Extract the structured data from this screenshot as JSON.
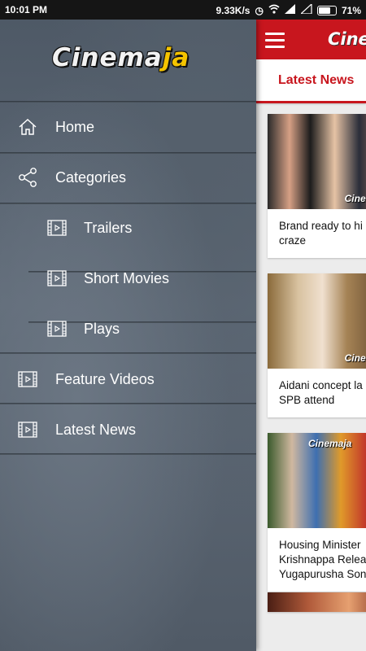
{
  "status": {
    "time": "10:01 PM",
    "speed": "9.33K/s",
    "battery": "71%"
  },
  "drawer": {
    "logo": {
      "part1": "Cinema",
      "part2": "ja"
    },
    "items": [
      {
        "label": "Home",
        "icon": "home-icon"
      },
      {
        "label": "Categories",
        "icon": "share-icon"
      },
      {
        "label": "Trailers",
        "icon": "film-icon"
      },
      {
        "label": "Short Movies",
        "icon": "film-icon"
      },
      {
        "label": "Plays",
        "icon": "film-icon"
      },
      {
        "label": "Feature Videos",
        "icon": "film-icon"
      },
      {
        "label": "Latest News",
        "icon": "film-icon"
      }
    ]
  },
  "app": {
    "logo": "Cinema",
    "tab": "Latest News",
    "accent": "#c8161e",
    "cards": [
      {
        "caption": "Brand ready to hi\ncraze",
        "watermark": "Cinemaja"
      },
      {
        "caption": "Aidani concept la\nSPB attend",
        "watermark": "Cinemaja"
      },
      {
        "caption": "Housing Minister\nKrishnappa Relea\nYugapurusha Son",
        "watermark": "Cinemaja"
      }
    ]
  }
}
